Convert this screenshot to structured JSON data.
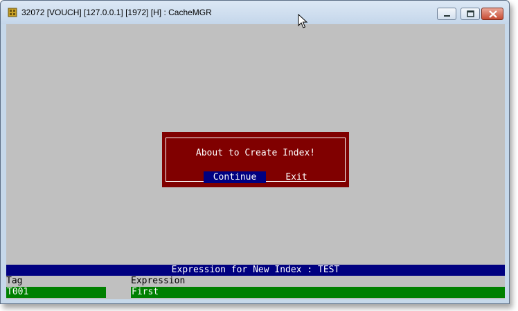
{
  "window": {
    "title": "32072 [VOUCH] [127.0.0.1] [1972] [H] : CacheMGR",
    "controls": {
      "minimize": "minimize",
      "maximize": "maximize",
      "close": "close"
    }
  },
  "dialog": {
    "message": "About to Create Index!",
    "continue_label": "Continue",
    "exit_label": "Exit"
  },
  "index_panel": {
    "header": "Expression for New Index : TEST",
    "tag_label": "Tag",
    "expression_label": "Expression",
    "tag_value": "T001",
    "expression_value": "First"
  },
  "colors": {
    "client_bg": "#c0c0c0",
    "dialog_bg": "#800000",
    "highlight": "#000080",
    "field_bg": "#008000"
  }
}
